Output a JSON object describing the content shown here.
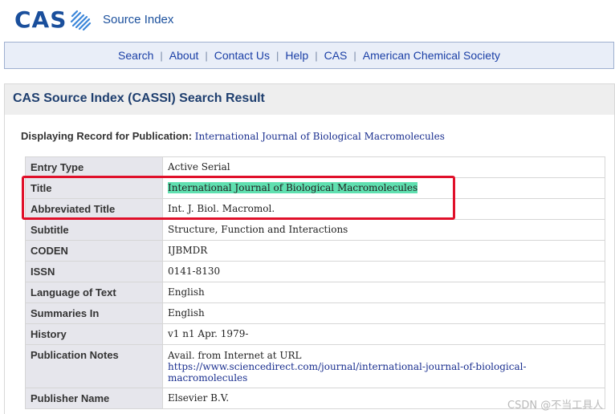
{
  "header": {
    "logo_text": "CAS",
    "logo_sub": "Source Index"
  },
  "nav": {
    "items": [
      "Search",
      "About",
      "Contact Us",
      "Help",
      "CAS",
      "American Chemical Society"
    ],
    "separator": "|"
  },
  "result": {
    "title": "CAS Source Index (CASSI) Search Result",
    "display_label": "Displaying Record for Publication:",
    "display_pub": "International Journal of Biological Macromolecules"
  },
  "record": {
    "rows": [
      {
        "label": "Entry Type",
        "value": "Active Serial"
      },
      {
        "label": "Title",
        "value": "International Journal of Biological Macromolecules"
      },
      {
        "label": "Abbreviated Title",
        "value": "Int. J. Biol. Macromol."
      },
      {
        "label": "Subtitle",
        "value": "Structure, Function and Interactions"
      },
      {
        "label": "CODEN",
        "value": "IJBMDR"
      },
      {
        "label": "ISSN",
        "value": "0141-8130"
      },
      {
        "label": "Language of Text",
        "value": "English"
      },
      {
        "label": "Summaries In",
        "value": "English"
      },
      {
        "label": "History",
        "value": "v1 n1 Apr. 1979-"
      },
      {
        "label": "Publication Notes",
        "value": "Avail. from Internet at URL",
        "url_line1": "https://www.sciencedirect.com/journal/international-journal-of-biological-",
        "url_line2": "macromolecules"
      },
      {
        "label": "Publisher Name",
        "value": "Elsevier B.V."
      }
    ]
  },
  "watermark": "CSDN @不当工具人",
  "colors": {
    "brand": "#1a4f9c",
    "highlight": "#5fe0b0",
    "annotation_box": "#e0102a"
  }
}
